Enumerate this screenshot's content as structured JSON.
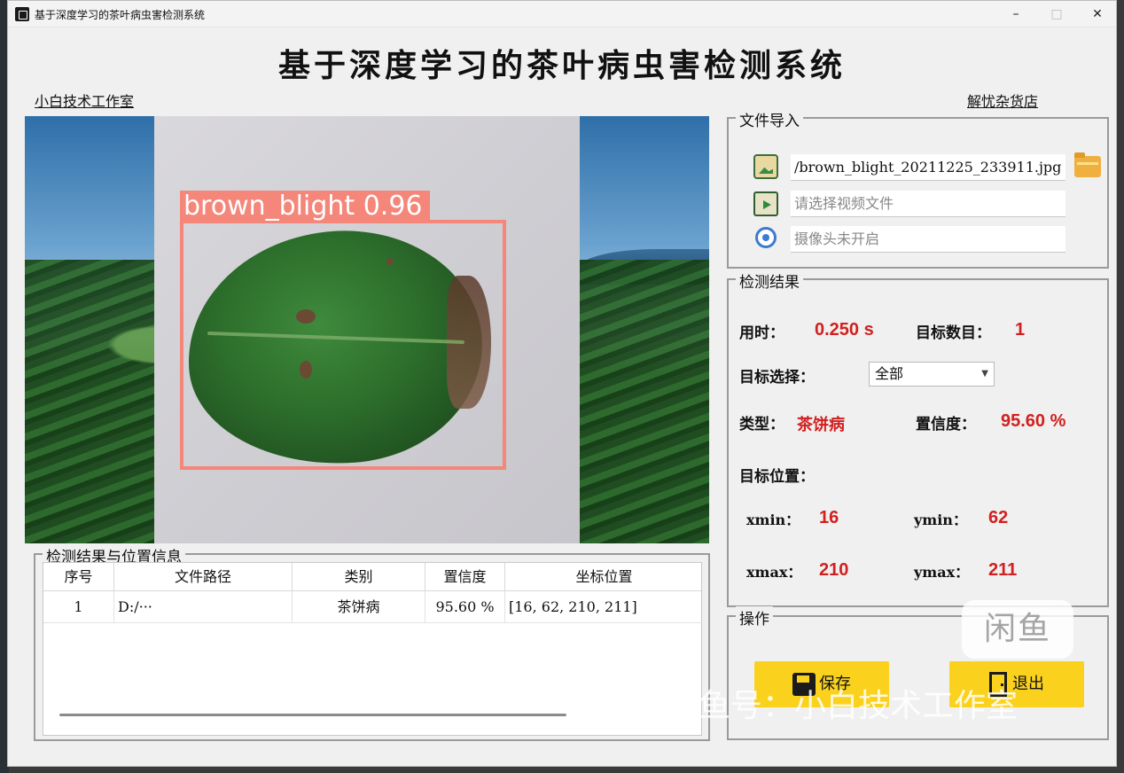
{
  "window": {
    "title": "基于深度学习的茶叶病虫害检测系统",
    "minimize": "–",
    "maximize": "□",
    "close": "✕"
  },
  "header": {
    "title": "基于深度学习的茶叶病虫害检测系统",
    "left_link": "小白技术工作室",
    "right_link": "解忧杂货店"
  },
  "image_panel": {
    "detection_label": "brown_blight 0.96"
  },
  "file_import": {
    "title": "文件导入",
    "image_path": "/brown_blight_20211225_233911.jpg",
    "video_placeholder": "请选择视频文件",
    "camera_status": "摄像头未开启",
    "icons": [
      "image-icon",
      "video-icon",
      "camera-icon",
      "folder-icon"
    ]
  },
  "detection_result": {
    "title": "检测结果",
    "time_label": "用时：",
    "time_value": "0.250 s",
    "count_label": "目标数目：",
    "count_value": "1",
    "select_label": "目标选择：",
    "select_value": "全部",
    "type_label": "类型：",
    "type_value": "茶饼病",
    "confidence_label": "置信度：",
    "confidence_value": "95.60 %",
    "position_label": "目标位置：",
    "xmin_label": "xmin：",
    "xmin_value": "16",
    "ymin_label": "ymin：",
    "ymin_value": "62",
    "xmax_label": "xmax：",
    "xmax_value": "210",
    "ymax_label": "ymax：",
    "ymax_value": "211"
  },
  "operations": {
    "title": "操作",
    "save_label": "保存",
    "exit_label": "退出"
  },
  "results_table": {
    "title": "检测结果与位置信息",
    "columns": [
      "序号",
      "文件路径",
      "类别",
      "置信度",
      "坐标位置"
    ],
    "rows": [
      [
        "1",
        "D:/···",
        "茶饼病",
        "95.60 %",
        "[16, 62, 210, 211]"
      ]
    ]
  },
  "watermark": {
    "logo": "闲鱼",
    "text": "闲鱼号：小白技术工作室"
  },
  "colors": {
    "accent_red": "#d21f1f",
    "button_yellow": "#fad21e",
    "detection_box": "#f4867a"
  }
}
